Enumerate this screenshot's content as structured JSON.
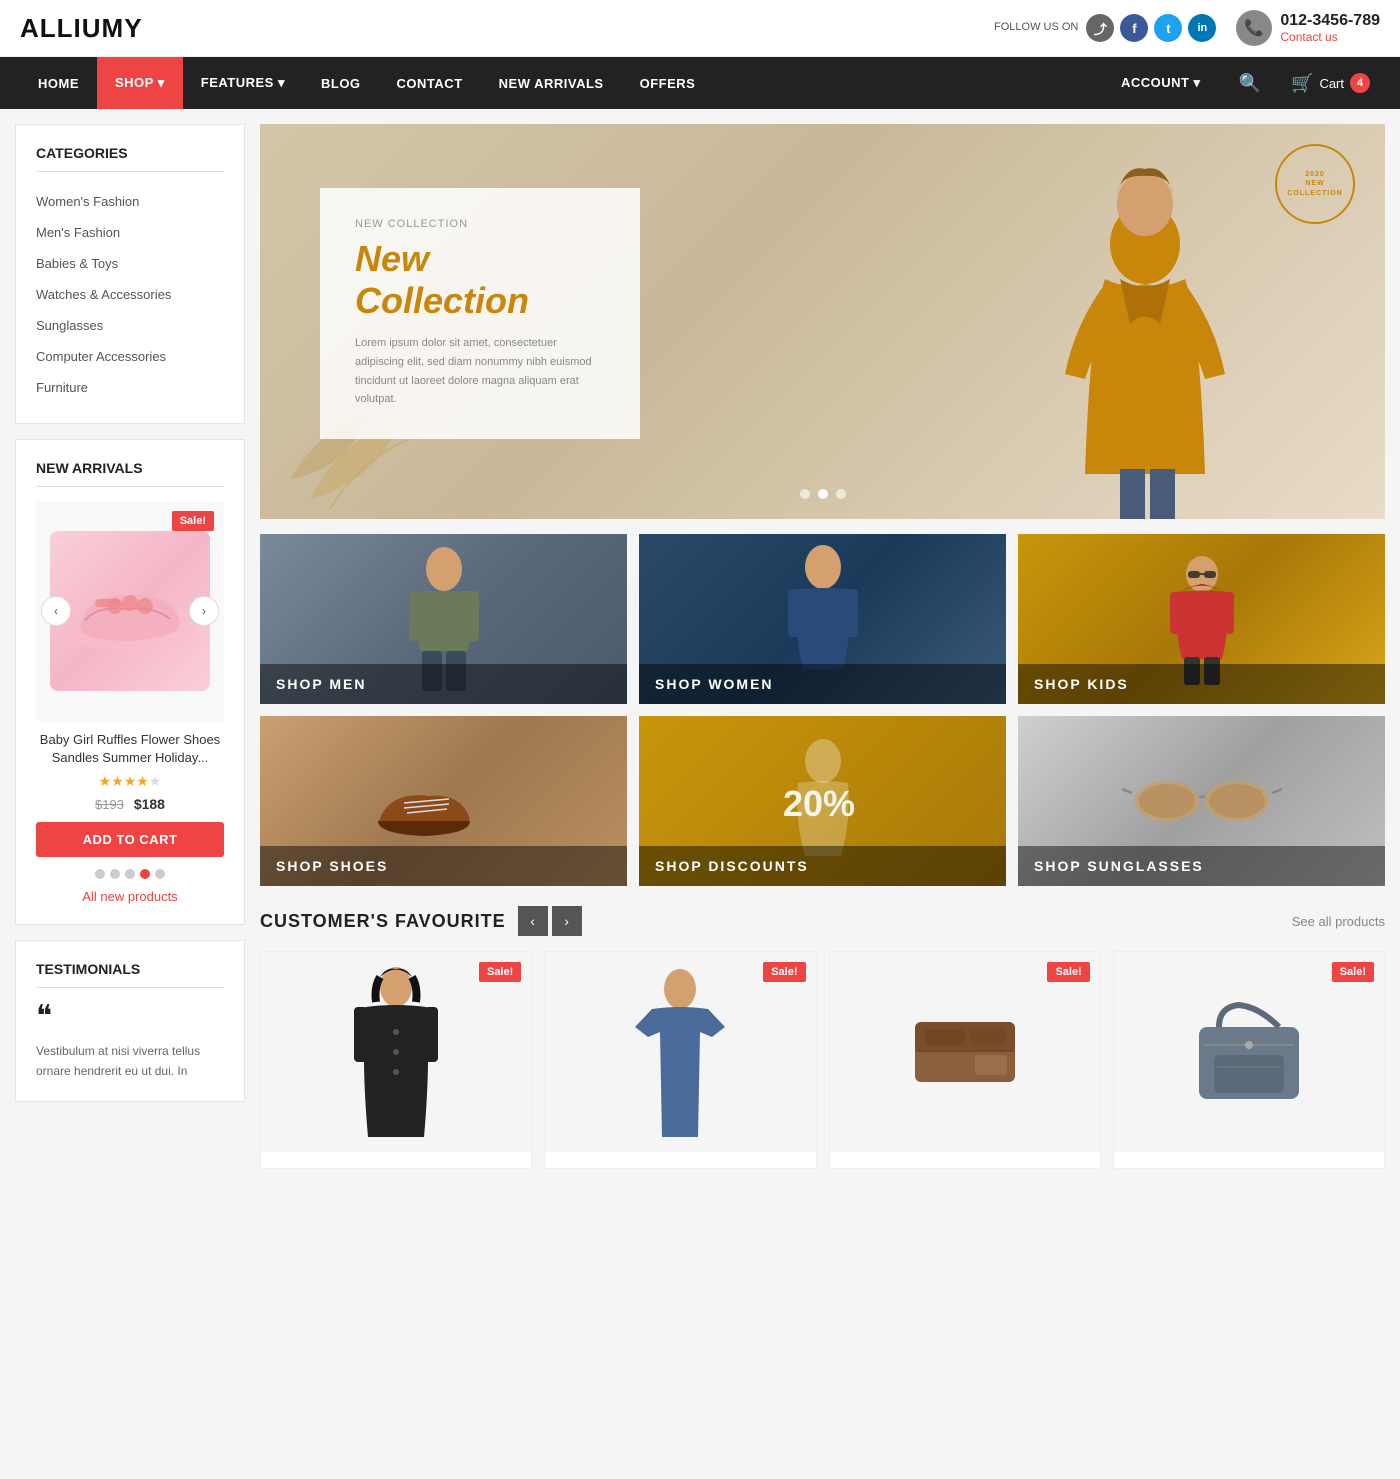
{
  "brand": {
    "logo": "ALLIUMY"
  },
  "topbar": {
    "follow_label": "FOLLOW US ON",
    "social": [
      {
        "name": "share",
        "icon": "⤴",
        "label": "share-icon"
      },
      {
        "name": "facebook",
        "icon": "f",
        "label": "facebook-icon"
      },
      {
        "name": "twitter",
        "icon": "t",
        "label": "twitter-icon"
      },
      {
        "name": "linkedin",
        "icon": "in",
        "label": "linkedin-icon"
      }
    ],
    "phone": "012-3456-789",
    "contact_link": "Contact us"
  },
  "nav": {
    "items": [
      {
        "label": "HOME",
        "active": false
      },
      {
        "label": "SHOP",
        "active": true,
        "has_dropdown": true
      },
      {
        "label": "FEATURES",
        "active": false,
        "has_dropdown": true
      },
      {
        "label": "BLOG",
        "active": false
      },
      {
        "label": "CONTACT",
        "active": false
      },
      {
        "label": "NEW ARRIVALS",
        "active": false
      },
      {
        "label": "OFFERS",
        "active": false
      }
    ],
    "account_label": "ACCOUNT",
    "cart_label": "Cart",
    "cart_count": "4"
  },
  "sidebar": {
    "categories_title": "CATEGORIES",
    "categories": [
      {
        "label": "Women's Fashion"
      },
      {
        "label": "Men's Fashion"
      },
      {
        "label": "Babies & Toys"
      },
      {
        "label": "Watches & Accessories"
      },
      {
        "label": "Sunglasses"
      },
      {
        "label": "Computer Accessories"
      },
      {
        "label": "Furniture"
      }
    ],
    "new_arrivals_title": "NEW ARRIVALS",
    "product": {
      "sale_badge": "Sale!",
      "name": "Baby Girl Ruffles Flower Shoes Sandles Summer Holiday...",
      "stars": 3.5,
      "old_price": "$193",
      "new_price": "$188",
      "add_to_cart": "Add to cart"
    },
    "dots": [
      {
        "active": false
      },
      {
        "active": false
      },
      {
        "active": false
      },
      {
        "active": true
      },
      {
        "active": false
      }
    ],
    "all_products_label": "All new products",
    "testimonials_title": "TESTIMONIALS",
    "testimonial_text": "Vestibulum at nisi viverra tellus ornare hendrerit eu ut dui. In"
  },
  "hero": {
    "badge": "2020 NEW COLLECTION",
    "subtitle": "New Collection",
    "description": "Lorem ipsum dolor sit amet, consectetuer adipiscing elit, sed diam nonummy nibh euismod tincidunt ut laoreet dolore magna aliquam erat volutpat.",
    "dots": [
      {
        "active": false
      },
      {
        "active": true
      },
      {
        "active": false
      }
    ]
  },
  "shop_grid": [
    {
      "label": "SHOP MEN",
      "bg_class": "shop-men-bg"
    },
    {
      "label": "SHOP WOMEN",
      "bg_class": "shop-women-bg"
    },
    {
      "label": "SHOP KIDS",
      "bg_class": "shop-kids-bg"
    },
    {
      "label": "SHOP SHOES",
      "bg_class": "shop-shoes-bg"
    },
    {
      "label": "SHOP DISCOUNTS",
      "bg_class": "shop-discounts-bg",
      "discount": "20%"
    },
    {
      "label": "SHOP SUNGLASSES",
      "bg_class": "shop-sunglasses-bg"
    }
  ],
  "customer_favourite": {
    "title": "CUSTOMER'S FAVOURITE",
    "see_all": "See all products",
    "products": [
      {
        "sale": true,
        "bg_class": "prod-coat",
        "fig_class": "fig-coat"
      },
      {
        "sale": true,
        "bg_class": "prod-tshirt",
        "fig_class": "fig-tshirt"
      },
      {
        "sale": true,
        "bg_class": "prod-wallet",
        "fig_class": "fig-wallet"
      },
      {
        "sale": true,
        "bg_class": "prod-bag",
        "fig_class": "fig-bag"
      }
    ]
  }
}
